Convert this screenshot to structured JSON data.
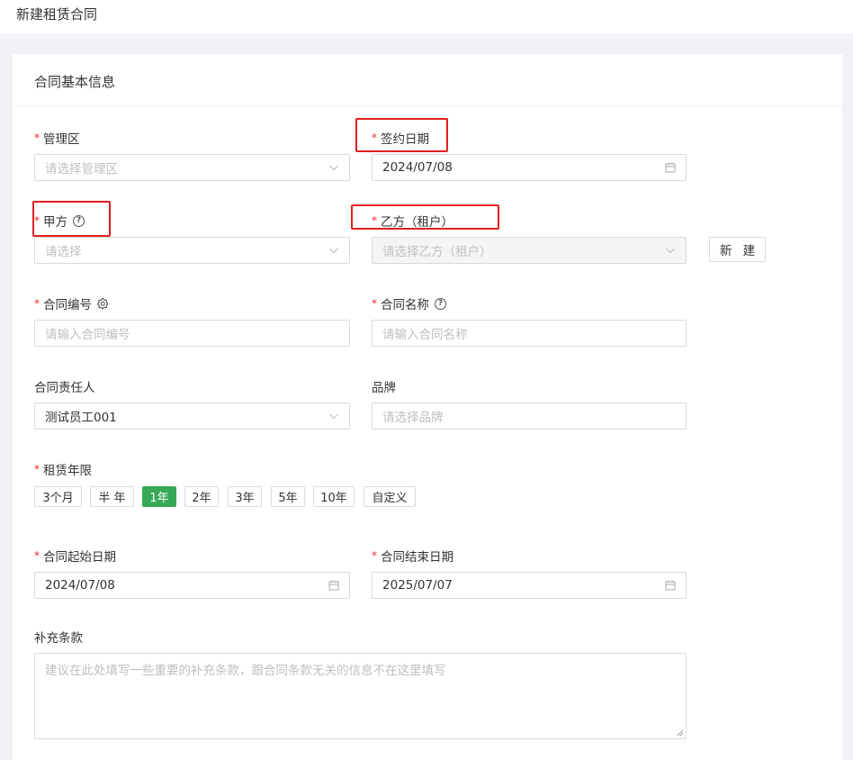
{
  "page": {
    "title": "新建租赁合同"
  },
  "section": {
    "title": "合同基本信息"
  },
  "fields": {
    "management_area": {
      "label": "管理区",
      "placeholder": "请选择管理区"
    },
    "sign_date": {
      "label": "签约日期",
      "value": "2024/07/08"
    },
    "party_a": {
      "label": "甲方",
      "placeholder": "请选择"
    },
    "party_b": {
      "label": "乙方（租户）",
      "placeholder": "请选择乙方（租户）",
      "new_button": "新 建"
    },
    "contract_no": {
      "label": "合同编号",
      "placeholder": "请输入合同编号"
    },
    "contract_name": {
      "label": "合同名称",
      "placeholder": "请输入合同名称"
    },
    "owner": {
      "label": "合同责任人",
      "value": "测试员工001"
    },
    "brand": {
      "label": "品牌",
      "placeholder": "请选择品牌"
    },
    "lease_term": {
      "label": "租赁年限",
      "options": [
        "3个月",
        "半 年",
        "1年",
        "2年",
        "3年",
        "5年",
        "10年",
        "自定义"
      ],
      "selected": "1年"
    },
    "start_date": {
      "label": "合同起始日期",
      "value": "2024/07/08"
    },
    "end_date": {
      "label": "合同结束日期",
      "value": "2025/07/07"
    },
    "supplement": {
      "label": "补充条款",
      "placeholder": "建议在此处填写一些重要的补充条款，跟合同条款无关的信息不在这里填写"
    }
  },
  "colors": {
    "accent": "#37a954",
    "required": "#f5222d",
    "highlight": "#e02020"
  },
  "icons": [
    "question-circle-icon",
    "gear-icon",
    "chevron-down-icon",
    "calendar-icon",
    "resize-handle-icon"
  ]
}
